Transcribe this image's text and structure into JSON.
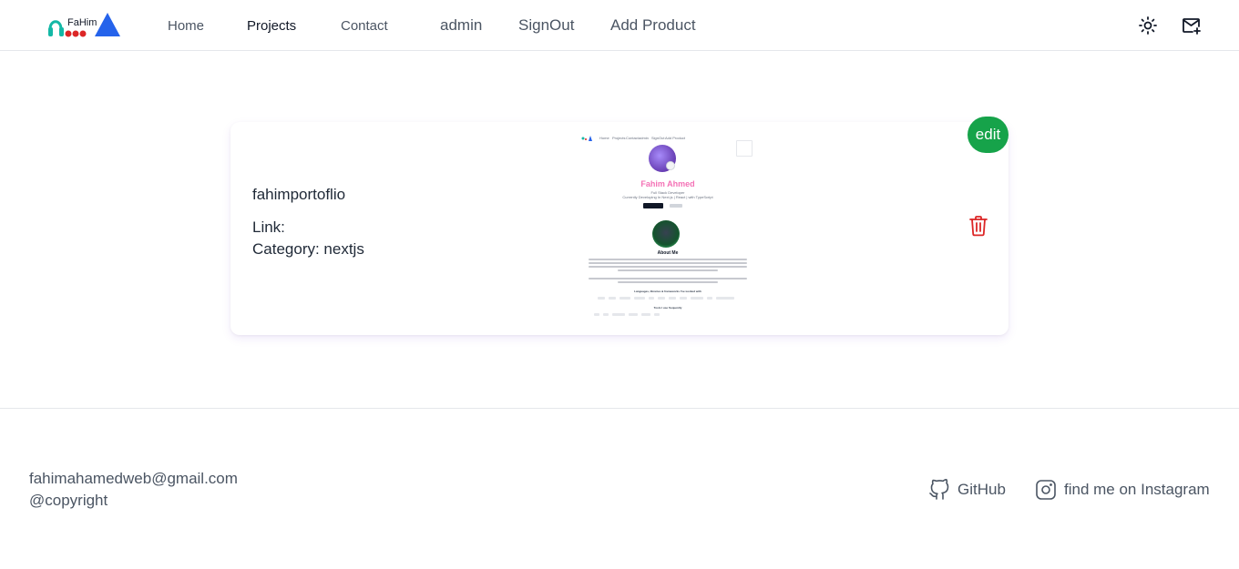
{
  "header": {
    "logo_text": "FaHim",
    "nav": {
      "home": "Home",
      "projects": "Projects",
      "contact": "Contact",
      "admin": "admin",
      "signout": "SignOut",
      "add_product": "Add Product"
    },
    "icons": {
      "theme": "sun-icon",
      "mail": "mail-plus-icon"
    }
  },
  "project_card": {
    "title": "fahimportoflio",
    "link_label": "Link:",
    "category_label": "Category: nextjs",
    "edit_label": "edit",
    "delete_icon": "trash-icon",
    "thumbnail": {
      "nav": [
        "Home",
        "Projects",
        "Contact",
        "admin",
        "SignOut",
        "Add Product"
      ],
      "name": "Fahim Ahmed",
      "role": "Full Stack Developer",
      "tagline": "Currently Developing In Next.js | React | with TypeScript",
      "about_title": "About Me",
      "languages_title": "Languages, libraries & frameworks I've worked with",
      "tools_title": "Tools I use frequently"
    }
  },
  "footer": {
    "email": "fahimahamedweb@gmail.com",
    "copyright": "@copyright",
    "github": "GitHub",
    "instagram": "find me on Instagram"
  },
  "colors": {
    "edit_green": "#16a34a",
    "delete_red": "#dc2626",
    "logo_blue": "#2563eb",
    "logo_red": "#dc2626",
    "logo_teal": "#14b8a6"
  }
}
